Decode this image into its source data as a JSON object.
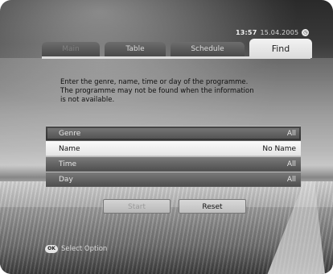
{
  "header": {
    "time": "13:57",
    "date": "15.04.2005",
    "clock_icon": "clock-icon"
  },
  "tabs": [
    {
      "label": "Main"
    },
    {
      "label": "Table"
    },
    {
      "label": "Schedule"
    },
    {
      "label": "Find"
    }
  ],
  "instructions": {
    "lines": [
      "Enter the genre, name, time or day of the programme.",
      "The programme may not be found when the information",
      "is not available."
    ]
  },
  "form": {
    "rows": [
      {
        "label": "Genre",
        "value": "All"
      },
      {
        "label": "Name",
        "value": "No Name"
      },
      {
        "label": "Time",
        "value": "All"
      },
      {
        "label": "Day",
        "value": "All"
      }
    ]
  },
  "buttons": {
    "start": "Start",
    "reset": "Reset"
  },
  "footer": {
    "ok_label": "OK",
    "hint": "Select Option"
  }
}
